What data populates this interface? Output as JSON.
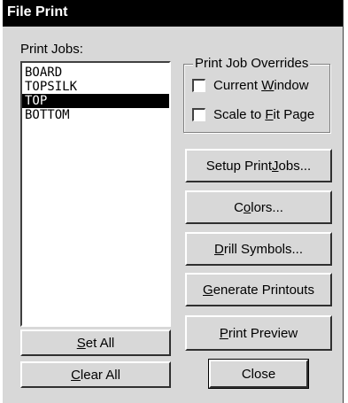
{
  "window": {
    "title": "File Print"
  },
  "print_jobs": {
    "label": "Print Jobs:",
    "items": [
      {
        "label": "BOARD",
        "selected": false
      },
      {
        "label": "TOPSILK",
        "selected": false
      },
      {
        "label": "TOP",
        "selected": true
      },
      {
        "label": "BOTTOM",
        "selected": false
      }
    ],
    "set_all_pre": "",
    "set_all_u": "S",
    "set_all_post": "et All",
    "clear_all_pre": "",
    "clear_all_u": "C",
    "clear_all_post": "lear All"
  },
  "overrides": {
    "legend": "Print Job Overrides",
    "current_window_pre": "Current ",
    "current_window_u": "W",
    "current_window_post": "indow",
    "scale_pre": "Scale to ",
    "scale_u": "F",
    "scale_post": "it Page"
  },
  "buttons": {
    "setup_pre": "Setup Print ",
    "setup_u": "J",
    "setup_post": "obs...",
    "colors_pre": "C",
    "colors_u": "o",
    "colors_post": "lors...",
    "drill_pre": "",
    "drill_u": "D",
    "drill_post": "rill Symbols...",
    "generate_pre": "",
    "generate_u": "G",
    "generate_post": "enerate Printouts",
    "preview_pre": "",
    "preview_u": "P",
    "preview_post": "rint Preview",
    "close": "Close"
  }
}
